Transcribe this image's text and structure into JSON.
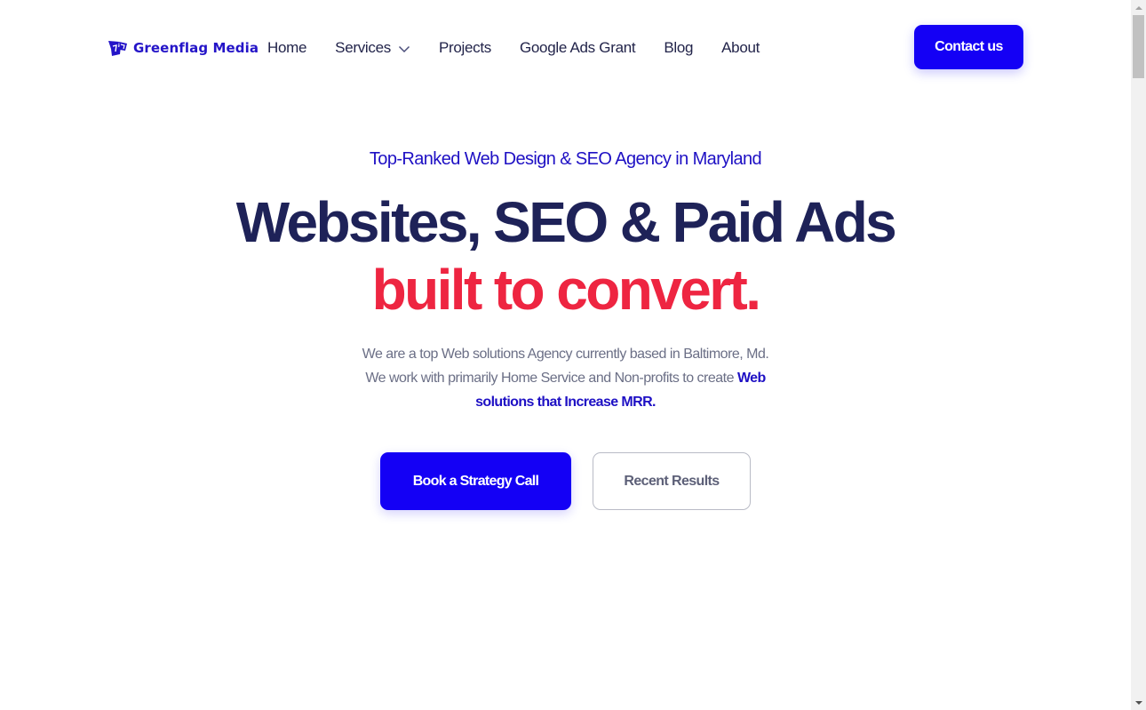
{
  "header": {
    "logo_text": "Greenflag Media",
    "logo_icon": "flag-logo-icon",
    "nav": [
      {
        "label": "Home"
      },
      {
        "label": "Services",
        "has_dropdown": true,
        "icon": "chevron-down-icon"
      },
      {
        "label": "Projects"
      },
      {
        "label": "Google Ads Grant"
      },
      {
        "label": "Blog"
      },
      {
        "label": "About"
      }
    ],
    "contact_label": "Contact us"
  },
  "hero": {
    "eyebrow": "Top-Ranked Web Design & SEO Agency in Maryland",
    "headline_line1": "Websites, SEO & Paid Ads",
    "headline_line2": "built to convert.",
    "description_prefix": "We are a top Web solutions Agency currently based in Baltimore, Md. We work with primarily Home Service and Non-profits to create ",
    "description_highlight": "Web solutions that Increase MRR.",
    "primary_cta": "Book a Strategy Call",
    "secondary_cta": "Recent Results"
  },
  "colors": {
    "brand_blue": "#1400f5",
    "eyebrow_blue": "#1e10c4",
    "headline_navy": "#1e2258",
    "accent_red": "#ee2541",
    "body_gray": "#6b6f86"
  },
  "scrollbar": {
    "up_icon": "scroll-up-arrow-icon",
    "down_icon": "scroll-down-arrow-icon"
  }
}
